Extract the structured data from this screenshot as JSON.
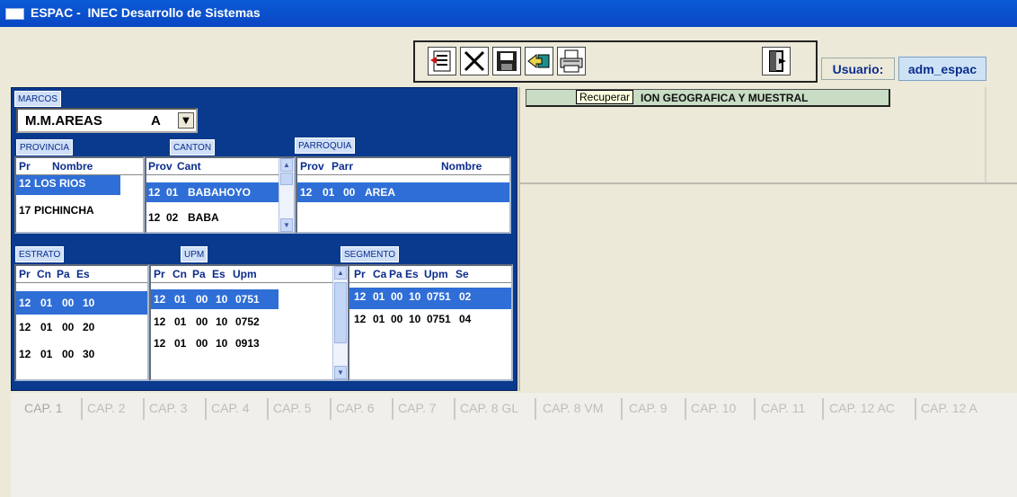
{
  "window": {
    "title": "ESPAC -  INEC Desarrollo de Sistemas"
  },
  "toolbar": {
    "buttons": [
      "list-doc-icon",
      "close-x-icon",
      "save-disk-icon",
      "recover-arrow-icon",
      "print-icon",
      "exit-door-icon"
    ],
    "tooltip": "Recuperar",
    "user_label": "Usuario:",
    "user_value": "adm_espac"
  },
  "marcos": {
    "header": "MARCOS",
    "selected": "M.M.AREAS",
    "code": "A"
  },
  "provincia": {
    "header": "PROVINCIA",
    "columns": [
      "Pr",
      "Nombre"
    ],
    "rows": [
      {
        "pr": "12",
        "nombre": "LOS RIOS",
        "selected": true
      },
      {
        "pr": "17",
        "nombre": "PICHINCHA",
        "selected": false
      }
    ]
  },
  "canton": {
    "header": "CANTON",
    "columns": [
      "Prov",
      "Cant"
    ],
    "rows": [
      {
        "prov": "12",
        "cant": "01",
        "nombre": "BABAHOYO",
        "selected": true
      },
      {
        "prov": "12",
        "cant": "02",
        "nombre": "BABA",
        "selected": false
      }
    ]
  },
  "parroquia": {
    "header": "PARROQUIA",
    "columns": [
      "Prov",
      "Parr",
      "Nombre"
    ],
    "rows": [
      {
        "prov": "12",
        "cant": "01",
        "parr": "00",
        "nombre": "AREA",
        "selected": true
      }
    ]
  },
  "estrato": {
    "header": "ESTRATO",
    "columns": [
      "Pr",
      "Cn",
      "Pa",
      "Es"
    ],
    "rows": [
      {
        "pr": "12",
        "cn": "01",
        "pa": "00",
        "es": "10",
        "selected": true
      },
      {
        "pr": "12",
        "cn": "01",
        "pa": "00",
        "es": "20",
        "selected": false
      },
      {
        "pr": "12",
        "cn": "01",
        "pa": "00",
        "es": "30",
        "selected": false
      }
    ]
  },
  "upm": {
    "header": "UPM",
    "columns": [
      "Pr",
      "Cn",
      "Pa",
      "Es",
      "Upm"
    ],
    "rows": [
      {
        "pr": "12",
        "cn": "01",
        "pa": "00",
        "es": "10",
        "upm": "0751",
        "selected": true
      },
      {
        "pr": "12",
        "cn": "01",
        "pa": "00",
        "es": "10",
        "upm": "0752",
        "selected": false
      },
      {
        "pr": "12",
        "cn": "01",
        "pa": "00",
        "es": "10",
        "upm": "0913",
        "selected": false
      }
    ]
  },
  "segmento": {
    "header": "SEGMENTO",
    "columns": [
      "Pr",
      "Ca",
      "Pa",
      "Es",
      "Upm",
      "Se"
    ],
    "rows": [
      {
        "pr": "12",
        "ca": "01",
        "pa": "00",
        "es": "10",
        "upm": "0751",
        "se": "02",
        "selected": true
      },
      {
        "pr": "12",
        "ca": "01",
        "pa": "00",
        "es": "10",
        "upm": "0751",
        "se": "04",
        "selected": false
      }
    ]
  },
  "right_panel": {
    "geo_label": "ION GEOGRAFICA Y MUESTRAL"
  },
  "tabs": [
    "CAP. 1",
    "CAP. 2",
    "CAP. 3",
    "CAP. 4",
    "CAP. 5",
    "CAP. 6",
    "CAP. 7",
    "CAP. 8 GL",
    "CAP. 8 VM",
    "CAP. 9",
    "CAP. 10",
    "CAP. 11",
    "CAP. 12 AC",
    "CAP. 12 A"
  ],
  "colors": {
    "title_bar": "#0a4fd0",
    "panel_blue": "#0a3a8e",
    "selection": "#2f6ed6",
    "tab_text": "#bdbdbd"
  }
}
